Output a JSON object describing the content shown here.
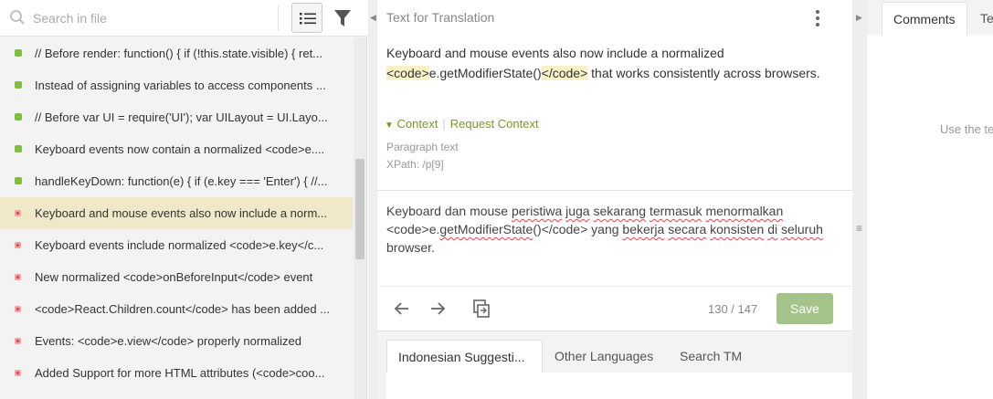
{
  "search": {
    "placeholder": "Search in file"
  },
  "toolbar": {
    "list_view": "list-icon",
    "filter": "filter-icon"
  },
  "segments": [
    {
      "status": "translated",
      "text": "// Before render: function() { if (!this.state.visible) { ret..."
    },
    {
      "status": "translated",
      "text": "Instead of assigning variables to access components ..."
    },
    {
      "status": "translated",
      "text": "// Before var UI = require('UI'); var UILayout = UI.Layo..."
    },
    {
      "status": "translated",
      "text": "Keyboard events now contain a normalized <code>e...."
    },
    {
      "status": "translated",
      "text": "handleKeyDown: function(e) { if (e.key === 'Enter') { //..."
    },
    {
      "status": "untranslated",
      "text": "Keyboard and mouse events also now include a norm...",
      "active": true
    },
    {
      "status": "untranslated",
      "text": "Keyboard events include normalized <code>e.key</c..."
    },
    {
      "status": "untranslated",
      "text": "New normalized <code>onBeforeInput</code> event"
    },
    {
      "status": "untranslated",
      "text": "<code>React.Children.count</code> has been added ..."
    },
    {
      "status": "untranslated",
      "text": "Events: <code>e.view</code> properly normalized"
    },
    {
      "status": "untranslated",
      "text": "Added Support for more HTML attributes (<code>coo..."
    }
  ],
  "center": {
    "header": "Text for Translation",
    "source": {
      "part1": "Keyboard and mouse events also now include a normalized ",
      "tag_open": "<code>",
      "middle": "e.getModifierState()",
      "tag_close": "</code>",
      "part2": " that works consistently across browsers."
    },
    "context_label": "Context",
    "request_context": "Request Context",
    "paragraph_label": "Paragraph text",
    "xpath": "XPath: /p[9]",
    "target": {
      "w1": "Keyboard dan mouse ",
      "w2": "peristiwa",
      "w3": " ",
      "w4": "juga",
      "w5": " ",
      "w6": "sekarang",
      "w7": " ",
      "w8": "termasuk",
      "w9": " ",
      "w10": "menormalkan",
      "w11": " <code>e.",
      "w12": "getModifierState",
      "w13": "()</code> yang ",
      "w14": "bekerja",
      "w15": " ",
      "w16": "secara",
      "w17": " ",
      "w18": "konsisten",
      "w19": " ",
      "w20": "di",
      "w21": " ",
      "w22": "seluruh",
      "w23": " browser."
    },
    "counter": "130 / 147",
    "save_label": "Save",
    "tabs": [
      "Indonesian Suggesti...",
      "Other Languages",
      "Search TM"
    ]
  },
  "right": {
    "tabs": [
      "Comments",
      "Te"
    ],
    "hint": "Use the te"
  },
  "colors": {
    "accent_green": "#7a9a1a",
    "save_button": "#a3c389",
    "active_row": "#f0e8c9",
    "translated": "#7fbf3f",
    "untranslated": "#e0474f"
  }
}
